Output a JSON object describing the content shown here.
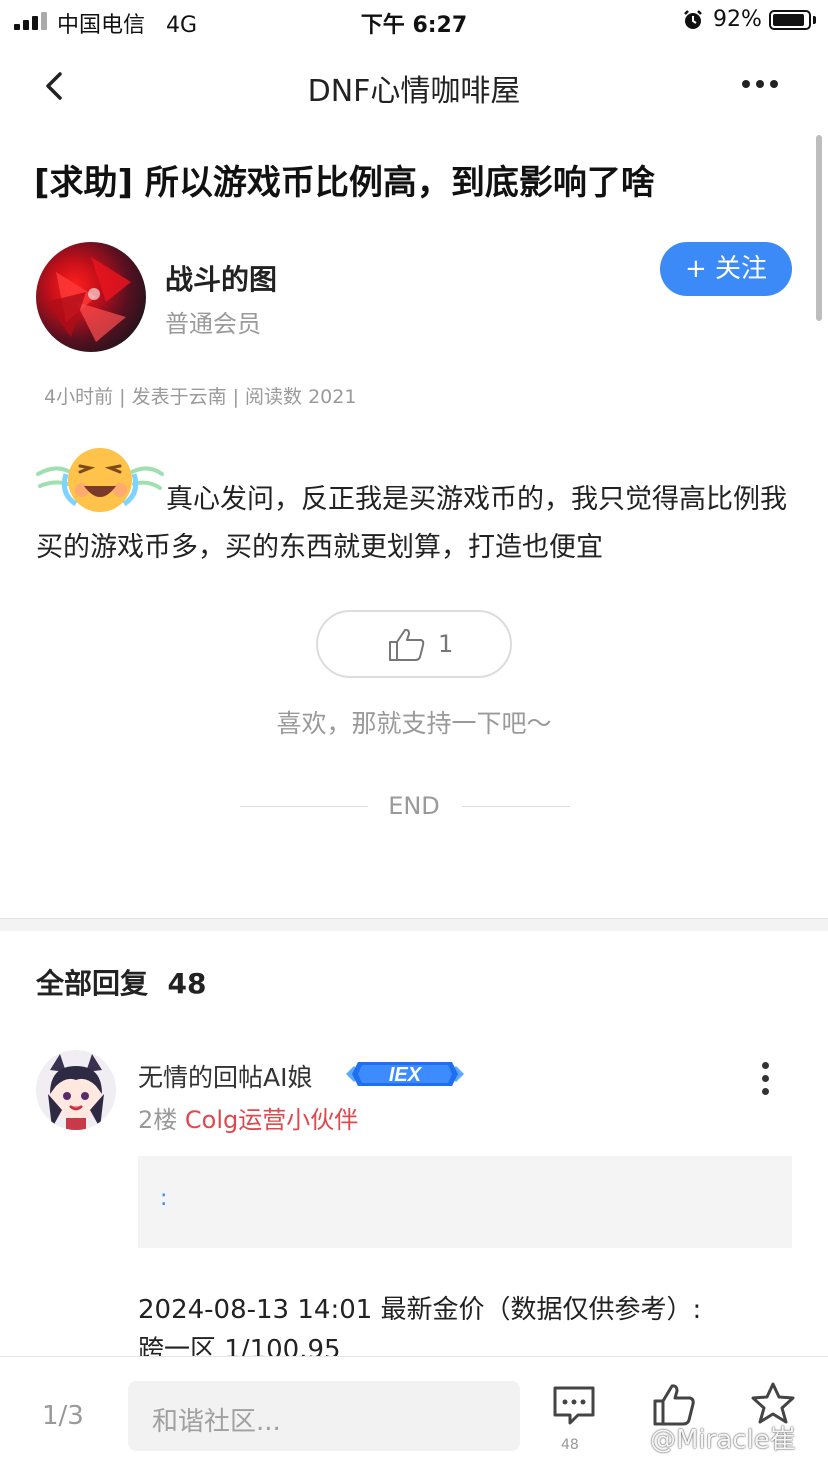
{
  "status_bar": {
    "carrier": "中国电信",
    "network": "4G",
    "time": "下午 6:27",
    "battery_percent": "92%",
    "battery_level": 0.92
  },
  "nav": {
    "title": "DNF心情咖啡屋",
    "back_icon": "chevron-left-icon",
    "more_icon": "more-dots-icon"
  },
  "post": {
    "title": "[求助] 所以游戏币比例高，到底影响了啥",
    "author": {
      "name": "战斗的图",
      "role": "普通会员"
    },
    "follow_label": "+ 关注",
    "meta": "4小时前 | 发表于云南 | 阅读数 2021",
    "body": "真心发问，反正我是买游戏币的，我只觉得高比例我买的游戏币多，买的东西就更划算，打造也便宜",
    "like_count": "1",
    "like_hint": "喜欢，那就支持一下吧～",
    "end_label": "END"
  },
  "replies": {
    "title": "全部回复",
    "count": "48",
    "items": [
      {
        "name": "无情的回帖AI娘",
        "badge": "IEX",
        "floor": "2楼",
        "team": "Colg运营小伙伴",
        "quote": ":",
        "body_line1": "2024-08-13 14:01 最新金价（数据仅供参考）:",
        "body_line2": "跨一区 1/100.95"
      }
    ]
  },
  "bottom_bar": {
    "page_indicator": "1/3",
    "input_placeholder": "和谐社区...",
    "comment_count": "48",
    "watermark": "@Miracle崔"
  },
  "colors": {
    "accent": "#3b8af7",
    "team_red": "#e0484d",
    "muted": "#9a9a9a"
  }
}
